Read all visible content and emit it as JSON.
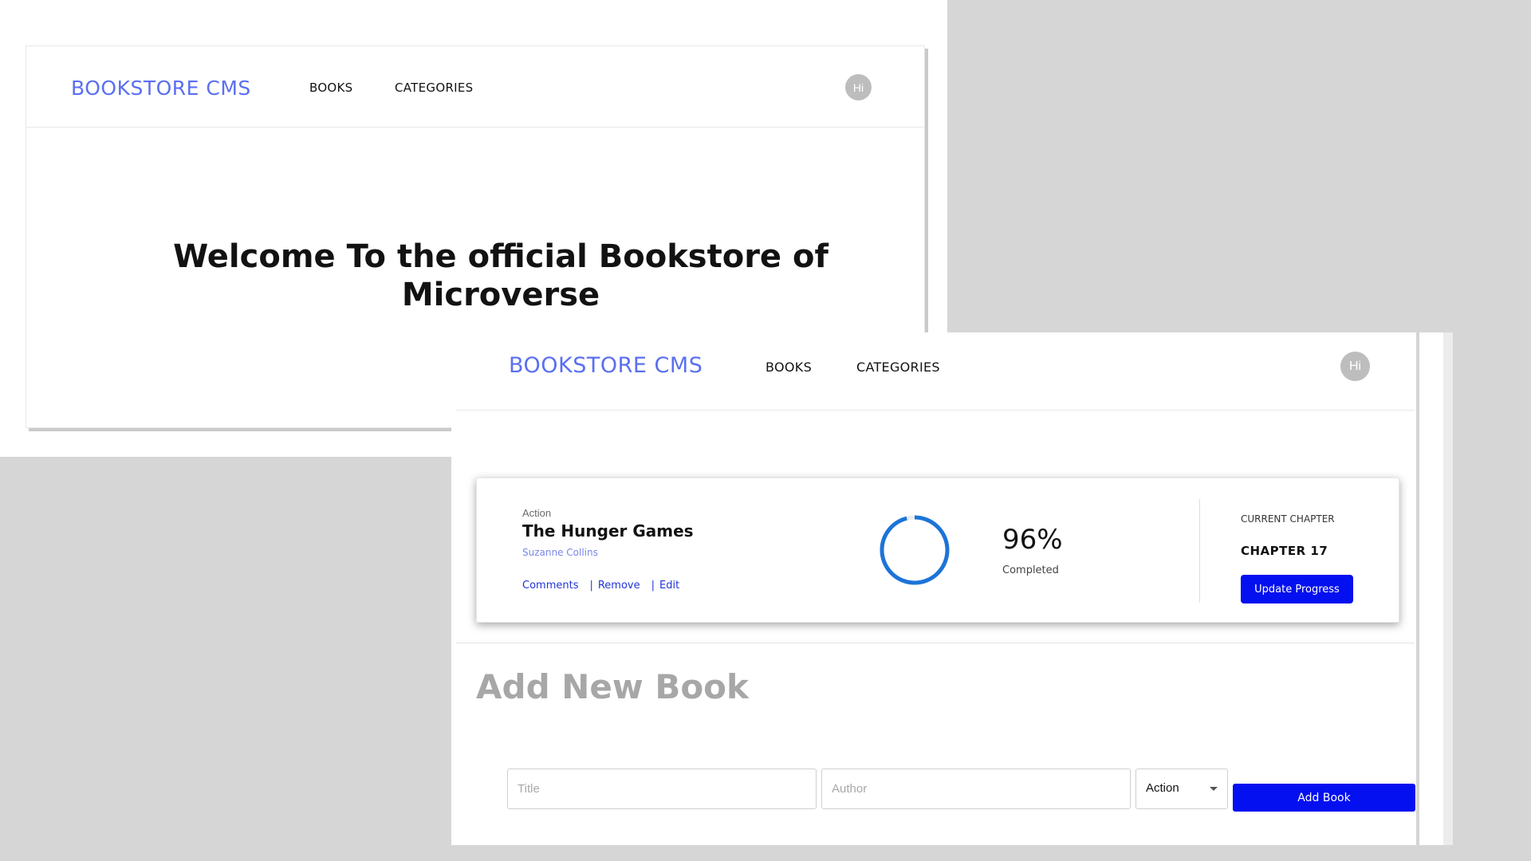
{
  "back_screen": {
    "header": {
      "logo": "BOOKSTORE CMS",
      "nav": [
        "BOOKS",
        "CATEGORIES"
      ],
      "avatar": "Hi"
    },
    "welcome_text": "Welcome To the official Bookstore of Microverse"
  },
  "front_screen": {
    "header": {
      "logo": "BOOKSTORE CMS",
      "nav": [
        "BOOKS",
        "CATEGORIES"
      ],
      "avatar": "Hi"
    },
    "book": {
      "genre": "Action",
      "title": "The Hunger Games",
      "author": "Suzanne Collins",
      "actions": [
        "Comments",
        "Remove",
        "Edit"
      ],
      "action_separator": "|",
      "progress_percent_value": 96,
      "progress_percent": "96%",
      "progress_label": "Completed",
      "current_chapter_label": "CURRENT CHAPTER",
      "current_chapter": "CHAPTER 17",
      "update_button": "Update Progress"
    },
    "add_form": {
      "heading": "Add New Book",
      "title_placeholder": "Title",
      "author_placeholder": "Author",
      "category_selected": "Action",
      "submit_label": "Add Book"
    }
  },
  "colors": {
    "brand_blue": "#0410f0",
    "logo_blue": "#5a6ff0",
    "progress_blue": "#1c74d8",
    "background_gray": "#d6d6d6"
  },
  "icons": {
    "select_caret": "chevron-down-icon",
    "progress": "progress-ring-icon"
  }
}
